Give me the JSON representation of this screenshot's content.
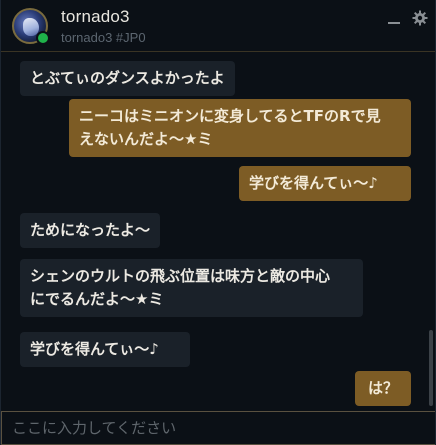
{
  "header": {
    "name": "tornado3",
    "tag": "tornado3 #JP0",
    "minimize_glyph": "—",
    "settings_icon": "gear-icon"
  },
  "messages": [
    {
      "side": "received",
      "text": "とぶてぃのダンスよかったよ"
    },
    {
      "side": "sent",
      "lines": [
        "ニーコはミニオンに変身してるとTFのRで見",
        "えないんだよ～★ミ"
      ]
    },
    {
      "side": "sent",
      "text": "学びを得んてぃ～♪"
    },
    {
      "side": "received",
      "text": "ためになったよ～"
    },
    {
      "side": "received",
      "lines": [
        "シェンのウルトの飛ぶ位置は味方と敵の中心",
        "にでるんだよ～★ミ"
      ]
    },
    {
      "side": "received",
      "text": "学びを得んてぃ～♪"
    },
    {
      "side": "sent",
      "text": "は？"
    }
  ],
  "input": {
    "placeholder": "ここに入力してください",
    "value": ""
  },
  "colors": {
    "sent_bubble": "#7d5c25",
    "received_bubble": "#1a2129",
    "online": "#1fb24a"
  }
}
